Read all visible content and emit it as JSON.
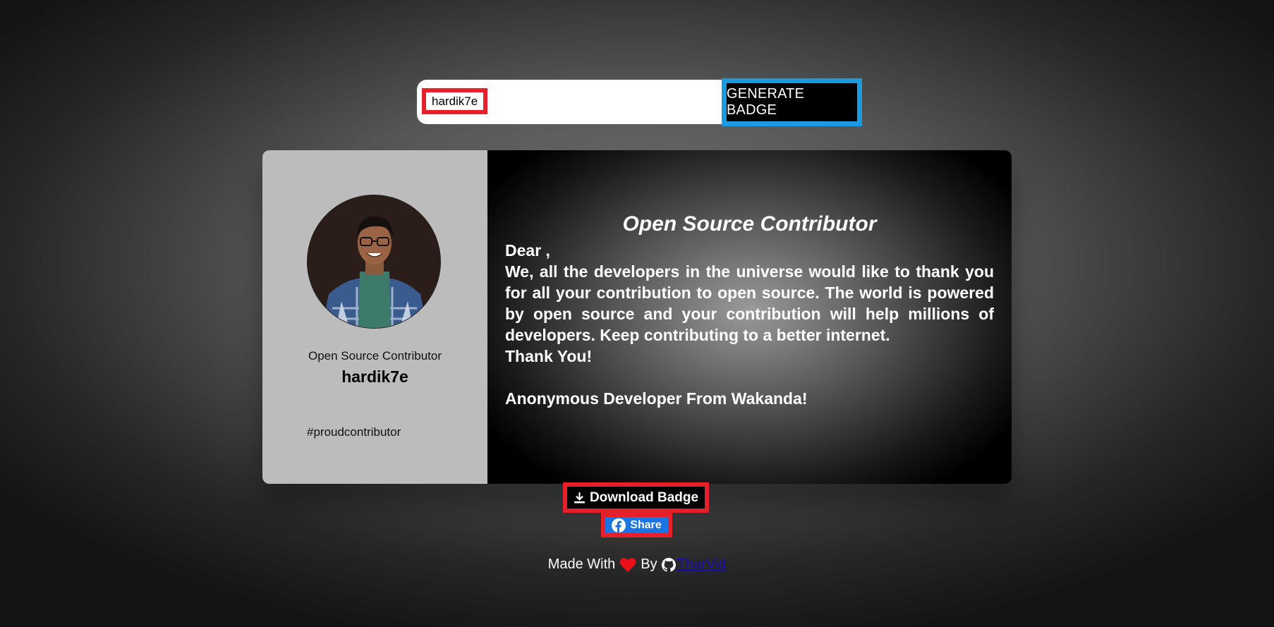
{
  "search": {
    "value": "hardik7e",
    "button_label": "GENERATE BADGE"
  },
  "badge": {
    "role": "Open Source Contributor",
    "username": "hardik7e",
    "hashtag": "#proudcontributor",
    "title": "Open Source Contributor",
    "greeting": "Dear ,",
    "body": "We, all the developers in the universe would like to thank you for all your contribution to open source. The world is powered by open source and your contribution will help millions of developers. Keep contributing to a better internet.",
    "thanks": "Thank You!",
    "signature": "Anonymous Developer From Wakanda!"
  },
  "actions": {
    "download_label": "Download Badge",
    "share_label": "Share"
  },
  "footer": {
    "made_with": "Made With",
    "by": "By",
    "author": "TharVid"
  },
  "icons": {
    "download": "download-icon",
    "facebook": "facebook-icon",
    "heart": "heart-icon",
    "github": "github-icon"
  },
  "colors": {
    "highlight_red": "#e5202a",
    "highlight_blue": "#1a9ae0",
    "facebook_blue": "#1b74e4",
    "heart_red": "#e8101a",
    "link_blue": "#1a0dab"
  }
}
